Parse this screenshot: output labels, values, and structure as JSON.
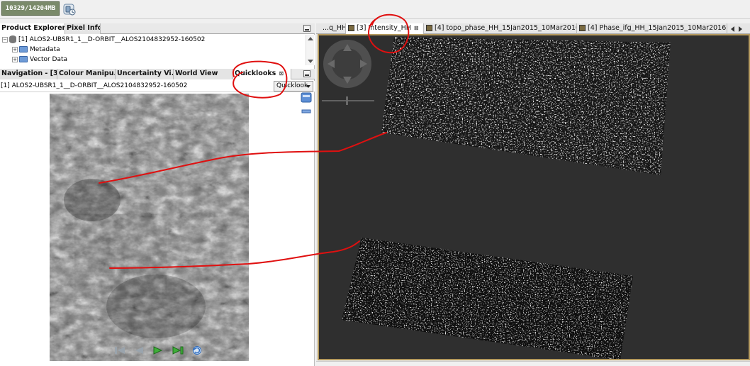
{
  "toolbar": {
    "memory_label": "10329/14204MB",
    "gc_icon": "garbage-collect-icon"
  },
  "left_panel": {
    "top_tabs": [
      {
        "label": "Product Explorer",
        "close": "⊠"
      },
      {
        "label": "Pixel Info"
      }
    ],
    "tree": {
      "product": "[1] ALOS2-UBSR1_1__D-ORBIT__ALOS2104832952-160502",
      "children": [
        "Metadata",
        "Vector Data"
      ]
    },
    "bottom_tabs": [
      {
        "label": "Navigation - [3]..."
      },
      {
        "label": "Colour Manipu..."
      },
      {
        "label": "Uncertainty Vi..."
      },
      {
        "label": "World View"
      },
      {
        "label": "Quicklooks",
        "close": "⊠"
      }
    ],
    "quicklook_product": "[1] ALOS2-UBSR1_1__D-ORBIT__ALOS2104832952-160502",
    "quicklook_select": "Quicklook"
  },
  "right_panel": {
    "tabs": [
      {
        "label": "...q_HH"
      },
      {
        "label": "[3] Intensity_HH",
        "close": "⊠"
      },
      {
        "label": "[4] topo_phase_HH_15Jan2015_10Mar2016",
        "close": "⊠"
      },
      {
        "label": "[4] Phase_ifg_HH_15Jan2015_10Mar2016..."
      }
    ]
  },
  "colors": {
    "canvas_bg": "#2f2f2f",
    "canvas_border": "#b59a5e",
    "annotation_red": "#e01010"
  }
}
